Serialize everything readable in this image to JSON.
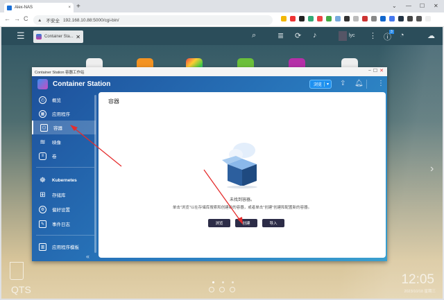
{
  "browser": {
    "tab_title": "Alex-NAS",
    "new_tab": "+",
    "minimize": "—",
    "maximize": "☐",
    "close": "✕",
    "dropdown": "⌄",
    "insecure_label": "不安全",
    "url": "192.168.10.88:5000/cgi-bin/"
  },
  "nas": {
    "open_app_tab": "Container Sta...",
    "user": "lyc"
  },
  "window": {
    "title": "Container Station 容器工作站",
    "app_name": "Container Station",
    "browse_button": "浏览",
    "notification_count": "3"
  },
  "sidebar": {
    "items": [
      {
        "label": "概览",
        "icon": "dashboard-icon"
      },
      {
        "label": "应用程序",
        "icon": "apps-icon"
      },
      {
        "label": "容器",
        "icon": "cube-icon"
      },
      {
        "label": "映像",
        "icon": "layers-icon"
      },
      {
        "label": "卷",
        "icon": "database-icon"
      },
      {
        "label": "Kubernetes",
        "icon": "helm-icon"
      },
      {
        "label": "存储库",
        "icon": "repository-icon"
      },
      {
        "label": "偏好设置",
        "icon": "gear-icon"
      },
      {
        "label": "事件日志",
        "icon": "log-icon"
      },
      {
        "label": "应用程序模板",
        "icon": "template-icon"
      }
    ],
    "collapse": "«"
  },
  "content": {
    "title": "容器",
    "empty_title": "未找到容器。",
    "empty_desc": "单击\"浏览\"以在存储库搜索和创建新的容器，或者单击\"创建\"创建和配置新的容器。",
    "buttons": [
      "浏览",
      "创建",
      "导入"
    ]
  },
  "desktop": {
    "brand": "QTS",
    "time": "12:05",
    "date": "2023/10/18 星期三"
  }
}
